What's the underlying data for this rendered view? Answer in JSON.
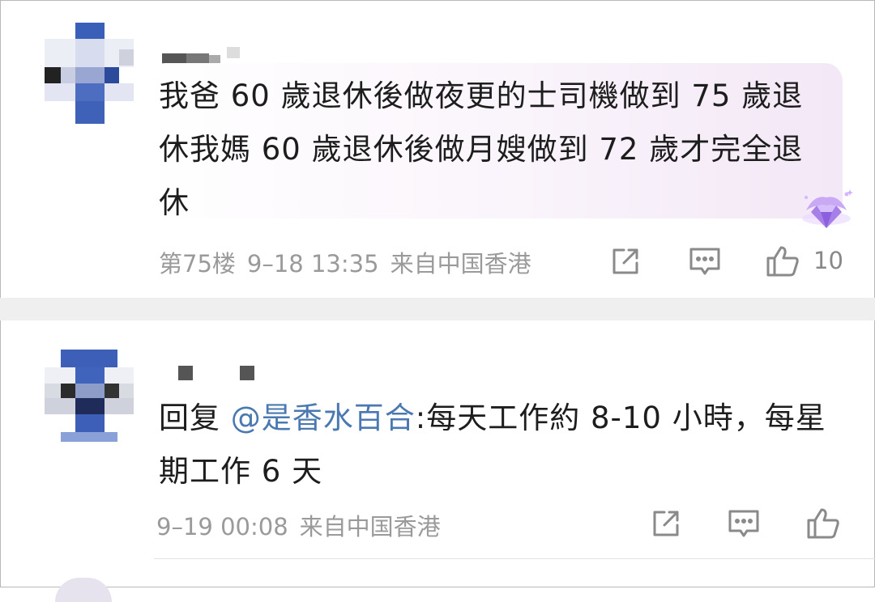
{
  "comments": [
    {
      "text": "我爸 60 歲退休後做夜更的士司機做到 75 歲退休我媽 60 歲退休後做月嫂做到 72 歲才完全退休",
      "floor": "第75楼",
      "time": "9–18 13:35",
      "location": "来自中国香港",
      "likes": "10",
      "badge_icon": "diamond-crown-badge-icon",
      "accent_color": "#a77fe8"
    },
    {
      "reply_prefix": "回复",
      "mention": "@是香水百合",
      "text": ":每天工作約 8-10 小時，每星期工作 6 天",
      "time": "9–19 00:08",
      "location": "来自中国香港",
      "mention_color": "#4a78b0"
    }
  ],
  "icons": {
    "share": "share-icon",
    "comment": "comment-icon",
    "like": "thumbs-up-icon"
  }
}
